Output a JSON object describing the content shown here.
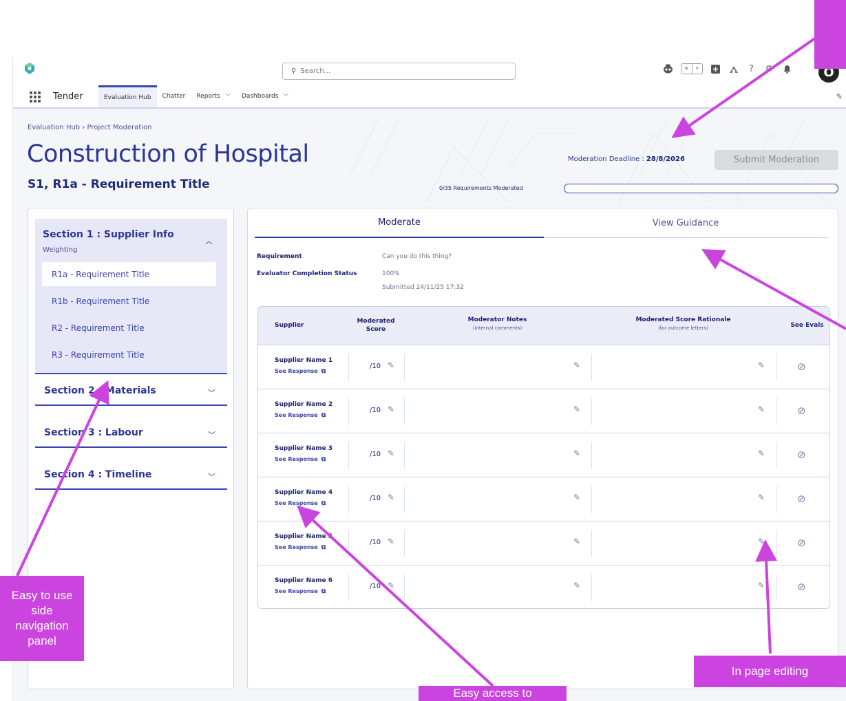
{
  "global_header": {
    "search_placeholder": "Search...",
    "icons": [
      "agentforce-icon",
      "favorites-star-icon",
      "favorites-dropdown-icon",
      "global-actions-icon",
      "trailhead-icon",
      "help-icon",
      "setup-gear-icon",
      "notifications-bell-icon"
    ],
    "avatar_initial": "O"
  },
  "app_nav": {
    "app_name": "Tender",
    "items": [
      {
        "label": "Evaluation Hub",
        "active": true,
        "has_menu": false
      },
      {
        "label": "Chatter",
        "active": false,
        "has_menu": false
      },
      {
        "label": "Reports",
        "active": false,
        "has_menu": true
      },
      {
        "label": "Dashboards",
        "active": false,
        "has_menu": true
      }
    ]
  },
  "page": {
    "breadcrumb": "Evaluation Hub › Project Moderation",
    "title": "Construction of Hospital",
    "subtitle": "S1, R1a - Requirement Title",
    "deadline_label": "Moderation Deadline : ",
    "deadline_value": "28/8/2026",
    "submit_label": "Submit Moderation",
    "progress_label": "0/35 Requirements Moderated",
    "progress_fraction": 0
  },
  "sidebar": {
    "sections": [
      {
        "title": "Section 1 : Supplier Info",
        "subtitle": "Weighting",
        "expanded": true,
        "items": [
          {
            "label": "R1a - Requirement Title",
            "active": true
          },
          {
            "label": "R1b - Requirement Title",
            "active": false
          },
          {
            "label": "R2 - Requirement Title",
            "active": false
          },
          {
            "label": "R3 - Requirement Title",
            "active": false
          }
        ]
      },
      {
        "title": "Section 2 : Materials",
        "expanded": false
      },
      {
        "title": "Section 3 : Labour",
        "expanded": false
      },
      {
        "title": "Section 4 : Timeline",
        "expanded": false
      }
    ]
  },
  "main": {
    "tabs": [
      {
        "label": "Moderate",
        "active": true
      },
      {
        "label": "View Guidance",
        "active": false
      }
    ],
    "requirement_label": "Requirement",
    "requirement_value": "Can you do this thing?",
    "status_label": "Evaluator Completion Status",
    "status_value": "100%",
    "submitted_value": "Submitted 24/11/25  17:32",
    "table": {
      "headers": {
        "supplier": "Supplier",
        "score": "Moderated Score",
        "notes": "Moderator Notes",
        "notes_sub": "(internal comments)",
        "rationale": "Moderated Score Rationale",
        "rationale_sub": "(for outcome letters)",
        "evals": "See Evals"
      },
      "rows": [
        {
          "supplier": "Supplier Name 1",
          "link": "See Response",
          "score": "/10"
        },
        {
          "supplier": "Supplier Name 2",
          "link": "See Response",
          "score": "/10"
        },
        {
          "supplier": "Supplier Name 3",
          "link": "See Response",
          "score": "/10"
        },
        {
          "supplier": "Supplier Name 4",
          "link": "See Response",
          "score": "/10"
        },
        {
          "supplier": "Supplier Name 5",
          "link": "See Response",
          "score": "/10"
        },
        {
          "supplier": "Supplier Name 6",
          "link": "See Response",
          "score": "/10"
        }
      ]
    }
  },
  "annotations": {
    "side_nav": "Easy to use side navigation panel",
    "editing": "In page editing",
    "access": "Easy access to",
    "top_right": "",
    "color": "#cc44e0"
  }
}
